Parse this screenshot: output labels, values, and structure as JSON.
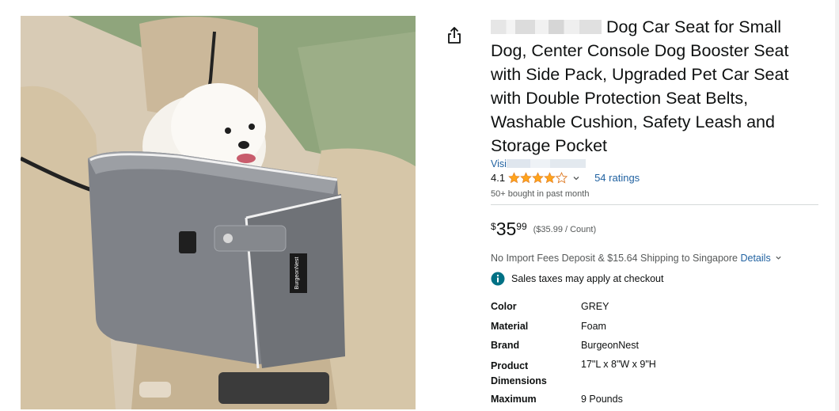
{
  "product": {
    "title": "Dog Car Seat for Small Dog, Center Console Dog Booster Seat with Side Pack, Upgraded Pet Car Seat with Double Protection Seat Belts, Washable Cushion, Safety Leash and Storage Pocket",
    "store_link": "Visi",
    "rating": "4.1",
    "rating_value": 4.1,
    "ratings_count": "54 ratings",
    "bought": "50+ bought in past month",
    "price": {
      "symbol": "$",
      "whole": "35",
      "fraction": "99",
      "unit_price": "($35.99 / Count)"
    },
    "shipping_text": "No Import Fees Deposit & $15.64 Shipping to Singapore",
    "shipping_details": "Details",
    "tax_note": "Sales taxes may apply at checkout",
    "specs": [
      {
        "key": "Color",
        "value": "GREY"
      },
      {
        "key": "Material",
        "value": "Foam"
      },
      {
        "key": "Brand",
        "value": "BurgeonNest"
      },
      {
        "key": "Product Dimensions",
        "value": "17\"L x 8\"W x 9\"H"
      },
      {
        "key": "Maximum",
        "value": "9 Pounds"
      }
    ]
  },
  "photo": {
    "brand_label": "BurgeonNest"
  },
  "icons": {
    "share": "share-icon",
    "star": "star-icon",
    "info": "info-icon",
    "chevron": "chevron-down-icon"
  },
  "colors": {
    "star": "#ffa41c",
    "link": "#2162a1",
    "info": "#007185"
  }
}
